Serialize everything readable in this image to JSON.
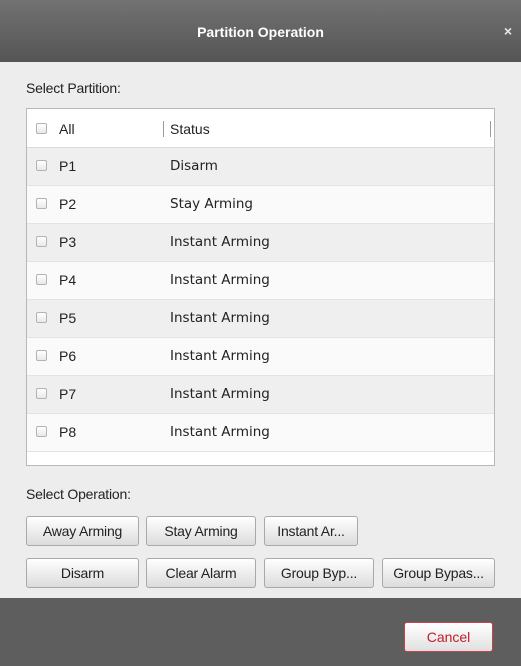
{
  "window": {
    "title": "Partition Operation",
    "close_glyph": "×"
  },
  "select_partition_label": "Select Partition:",
  "table": {
    "headers": {
      "name": "All",
      "status": "Status"
    },
    "rows": [
      {
        "name": "P1",
        "status": "Disarm",
        "checked": false
      },
      {
        "name": "P2",
        "status": "Stay Arming",
        "checked": false
      },
      {
        "name": "P3",
        "status": "Instant Arming",
        "checked": false
      },
      {
        "name": "P4",
        "status": "Instant Arming",
        "checked": false
      },
      {
        "name": "P5",
        "status": "Instant Arming",
        "checked": false
      },
      {
        "name": "P6",
        "status": "Instant Arming",
        "checked": false
      },
      {
        "name": "P7",
        "status": "Instant Arming",
        "checked": false
      },
      {
        "name": "P8",
        "status": "Instant Arming",
        "checked": false
      }
    ]
  },
  "select_operation_label": "Select Operation:",
  "operations": {
    "away_arming": "Away Arming",
    "stay_arming": "Stay Arming",
    "instant_arming": "Instant Ar...",
    "disarm": "Disarm",
    "clear_alarm": "Clear Alarm",
    "group_bypass": "Group Byp...",
    "group_bypass_recovery": "Group Bypas..."
  },
  "footer": {
    "cancel_label": "Cancel"
  },
  "colors": {
    "titlebar": "#5f5f5f",
    "cancel_text": "#c0202c",
    "cancel_border": "#c9414a"
  }
}
